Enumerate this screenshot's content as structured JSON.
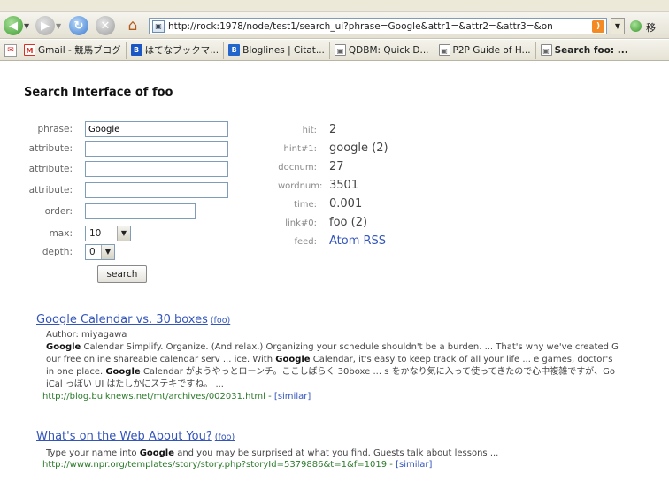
{
  "browser": {
    "url": "http://rock:1978/node/test1/search_ui?phrase=Google&attr1=&attr2=&attr3=&on",
    "go_label": "移"
  },
  "bookmarks": [
    {
      "label": "Gmail - 競馬ブログ",
      "icon": "gmail-icon",
      "color": "#d93025"
    },
    {
      "label": "はてなブックマ...",
      "icon": "hatena-icon",
      "color": "#1a56c4"
    },
    {
      "label": "Bloglines | Citat...",
      "icon": "bloglines-icon",
      "color": "#2266cc"
    },
    {
      "label": "QDBM: Quick D...",
      "icon": "page-icon",
      "color": "#888888"
    },
    {
      "label": "P2P Guide of H...",
      "icon": "page-icon",
      "color": "#888888"
    },
    {
      "label": "Search foo: ...",
      "icon": "page-icon",
      "color": "#888888"
    }
  ],
  "page": {
    "title": "Search Interface of foo",
    "form": {
      "phrase_label": "phrase:",
      "phrase_value": "Google",
      "attribute_label": "attribute:",
      "order_label": "order:",
      "max_label": "max:",
      "max_value": "10",
      "depth_label": "depth:",
      "depth_value": "0",
      "search_button": "search"
    },
    "stats": [
      {
        "label": "hit:",
        "value": "2"
      },
      {
        "label": "hint#1:",
        "value": "google (2)"
      },
      {
        "label": "docnum:",
        "value": "27"
      },
      {
        "label": "wordnum:",
        "value": "3501"
      },
      {
        "label": "time:",
        "value": "0.001"
      },
      {
        "label": "link#0:",
        "value": "foo (2)"
      },
      {
        "label": "feed:",
        "value": "Atom RSS"
      }
    ],
    "results": [
      {
        "title": "Google Calendar vs. 30 boxes",
        "tag": "(foo)",
        "author": "Author: miyagawa",
        "snippet_lines": [
          "Google Calendar Simplify. Organize. (And relax.) Organizing your schedule shouldn't be a burden. ... That's why we've created G",
          "our free online shareable calendar serv ... ice. With Google Calendar, it's easy to keep track of all your life ... e games, doctor's",
          "in one place. Google Calendar がようやっとローンチ。ここしばらく 30boxe ... s をかなり気に入って使ってきたので心中複雑ですが、Go",
          "iCal っぽい UI はたしかにステキですね。 ..."
        ],
        "url": "http://blog.bulknews.net/mt/archives/002031.html",
        "sep": " - ",
        "similar": "[similar]"
      },
      {
        "title": "What's on the Web About You?",
        "tag": "(foo)",
        "author": "",
        "snippet_lines": [
          "Type your name into Google and you may be surprised at what you find. Guests talk about lessons ..."
        ],
        "url": "http://www.npr.org/templates/story/story.php?storyId=5379886&t=1&f=1019",
        "sep": " - ",
        "similar": "[similar]"
      }
    ]
  }
}
